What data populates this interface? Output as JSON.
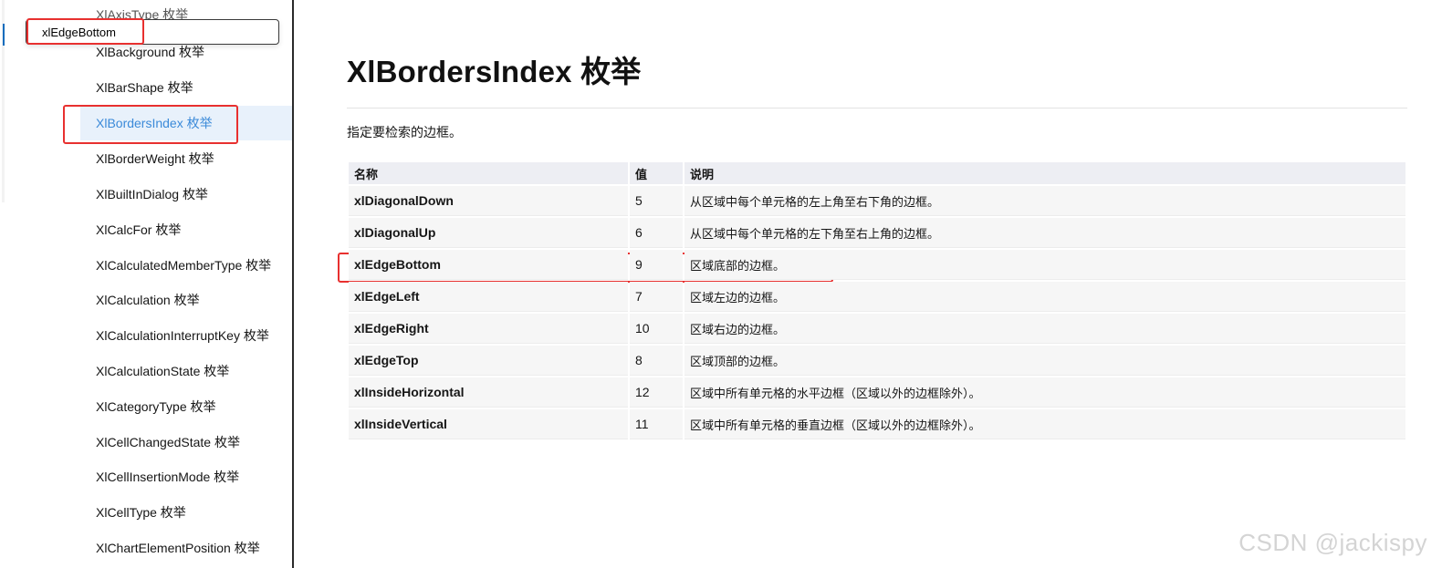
{
  "search": {
    "value": "xlEdgeBottom"
  },
  "sidebar": {
    "clipped_item": "XlAxisType 枚举",
    "items": [
      {
        "label": "XlBackground 枚举",
        "selected": false
      },
      {
        "label": "XlBarShape 枚举",
        "selected": false
      },
      {
        "label": "XlBordersIndex 枚举",
        "selected": true
      },
      {
        "label": "XlBorderWeight 枚举",
        "selected": false
      },
      {
        "label": "XlBuiltInDialog 枚举",
        "selected": false
      },
      {
        "label": "XlCalcFor 枚举",
        "selected": false
      },
      {
        "label": "XlCalculatedMemberType 枚举",
        "selected": false
      },
      {
        "label": "XlCalculation 枚举",
        "selected": false
      },
      {
        "label": "XlCalculationInterruptKey 枚举",
        "selected": false
      },
      {
        "label": "XlCalculationState 枚举",
        "selected": false
      },
      {
        "label": "XlCategoryType 枚举",
        "selected": false
      },
      {
        "label": "XlCellChangedState 枚举",
        "selected": false
      },
      {
        "label": "XlCellInsertionMode 枚举",
        "selected": false
      },
      {
        "label": "XlCellType 枚举",
        "selected": false
      },
      {
        "label": "XlChartElementPosition 枚举",
        "selected": false
      }
    ]
  },
  "main": {
    "title": "XlBordersIndex 枚举",
    "description": "指定要检索的边框。",
    "table": {
      "headers": {
        "name": "名称",
        "value": "值",
        "desc": "说明"
      },
      "rows": [
        {
          "name": "xlDiagonalDown",
          "value": "5",
          "desc": "从区域中每个单元格的左上角至右下角的边框。"
        },
        {
          "name": "xlDiagonalUp",
          "value": "6",
          "desc": "从区域中每个单元格的左下角至右上角的边框。"
        },
        {
          "name": "xlEdgeBottom",
          "value": "9",
          "desc": "区域底部的边框。"
        },
        {
          "name": "xlEdgeLeft",
          "value": "7",
          "desc": "区域左边的边框。"
        },
        {
          "name": "xlEdgeRight",
          "value": "10",
          "desc": "区域右边的边框。"
        },
        {
          "name": "xlEdgeTop",
          "value": "8",
          "desc": "区域顶部的边框。"
        },
        {
          "name": "xlInsideHorizontal",
          "value": "12",
          "desc": "区域中所有单元格的水平边框（区域以外的边框除外）。"
        },
        {
          "name": "xlInsideVertical",
          "value": "11",
          "desc": "区域中所有单元格的垂直边框（区域以外的边框除外）。"
        }
      ]
    }
  },
  "watermark": "CSDN @jackispy",
  "colors": {
    "highlight": "#e8302f",
    "selected_text": "#3b8ad9",
    "selected_bg": "#e8f1fb"
  }
}
